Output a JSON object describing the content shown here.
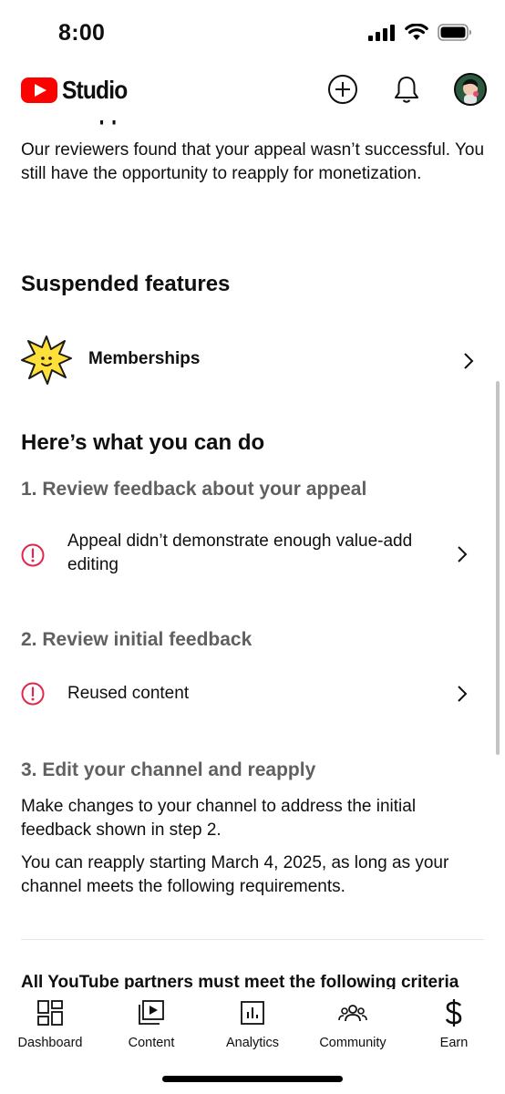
{
  "status_bar": {
    "time": "8:00"
  },
  "header": {
    "logo_text": "Studio"
  },
  "sections": {
    "cut_heading": "What happened?",
    "what_happened_body": "Our reviewers found that your appeal wasn’t successful. You still have the opportunity to reapply for monetization.",
    "suspended_title": "Suspended features",
    "suspended_items": [
      {
        "label": "Memberships",
        "icon": "memberships-star-icon"
      }
    ],
    "what_you_can_do_title": "Here’s what you can do",
    "step1_title": "1. Review feedback about your appeal",
    "step1_items": [
      {
        "label": "Appeal didn’t demonstrate enough value-add editing",
        "icon": "alert-circle-icon"
      }
    ],
    "step2_title": "2. Review initial feedback",
    "step2_items": [
      {
        "label": "Reused content",
        "icon": "alert-circle-icon"
      }
    ],
    "step3_title": "3. Edit your channel and reapply",
    "step3_body1": "Make changes to your channel to address the initial feedback shown in step 2.",
    "step3_body2": "You can reapply starting March 4, 2025, as long as your channel meets the following requirements.",
    "criteria_heading": "All YouTube partners must meet the following criteria"
  },
  "bottom_nav": [
    {
      "label": "Dashboard",
      "icon": "dashboard-icon"
    },
    {
      "label": "Content",
      "icon": "content-icon"
    },
    {
      "label": "Analytics",
      "icon": "analytics-icon"
    },
    {
      "label": "Community",
      "icon": "community-icon"
    },
    {
      "label": "Earn",
      "icon": "earn-icon"
    }
  ],
  "colors": {
    "brand_red": "#ff0000",
    "alert_red": "#e2274d",
    "secondary_text": "#606060"
  }
}
